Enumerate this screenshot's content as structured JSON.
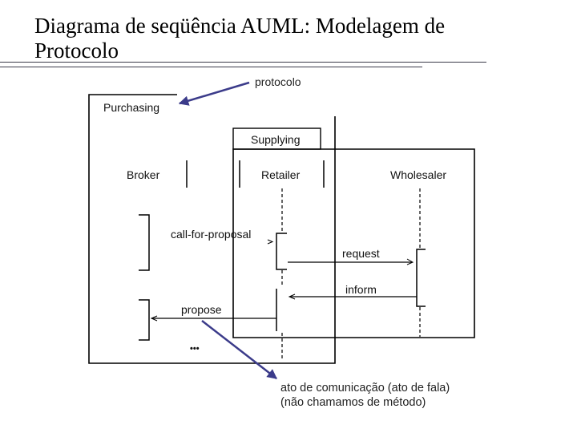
{
  "slide": {
    "title": "Diagrama de seqüência AUML: Modelagem de Protocolo"
  },
  "annotations": {
    "protocol_note": "protocolo",
    "speech_act_note_line1": "ato de comunicação (ato de fala)",
    "speech_act_note_line2": "(não chamamos de método)",
    "annotation_color": "#3b3b8a"
  },
  "diagram": {
    "outer_frame_label": "Purchasing",
    "inner_frame_label": "Supplying",
    "roles": [
      {
        "name": "Broker"
      },
      {
        "name": "Retailer"
      },
      {
        "name": "Wholesaler"
      }
    ],
    "messages": [
      {
        "label": "call-for-proposal",
        "from": "Broker",
        "to": "Retailer"
      },
      {
        "label": "request",
        "from": "Retailer",
        "to": "Wholesaler"
      },
      {
        "label": "inform",
        "from": "Wholesaler",
        "to": "Retailer"
      },
      {
        "label": "propose",
        "from": "Retailer",
        "to": "Broker"
      }
    ],
    "continuation": "•••"
  }
}
